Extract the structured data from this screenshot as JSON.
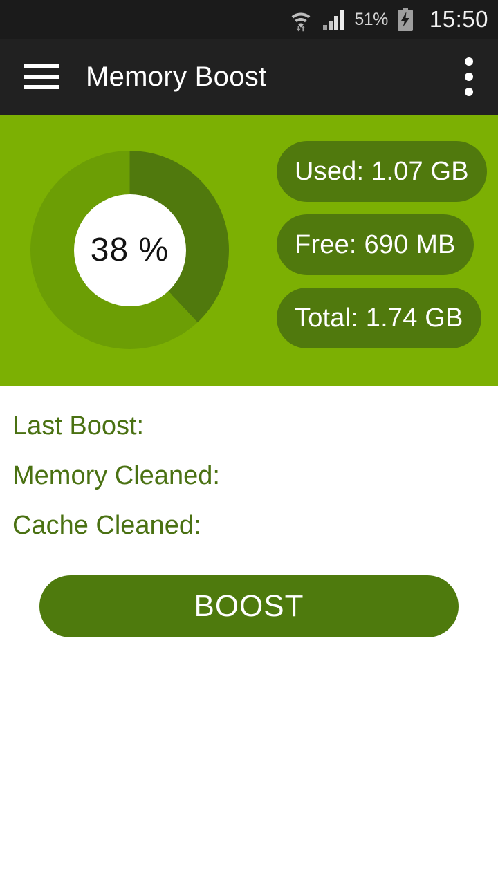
{
  "status_bar": {
    "wifi_icon": "wifi-icon",
    "signal_icon": "cellular-signal-icon",
    "battery_percent": "51%",
    "battery_icon": "battery-charging-icon",
    "time": "15:50"
  },
  "app_bar": {
    "menu_icon": "hamburger-menu-icon",
    "title": "Memory Boost",
    "overflow_icon": "overflow-menu-icon"
  },
  "memory": {
    "percent_label": "38 %",
    "percent_value": 38,
    "used": "Used: 1.07 GB",
    "free": "Free: 690 MB",
    "total": "Total: 1.74 GB"
  },
  "stats": [
    {
      "label": "Last Boost:",
      "value": ""
    },
    {
      "label": "Memory Cleaned:",
      "value": ""
    },
    {
      "label": "Cache Cleaned:",
      "value": ""
    }
  ],
  "actions": {
    "boost_label": "BOOST"
  },
  "colors": {
    "status_bar_bg": "#1b1b1b",
    "app_bar_bg": "#212121",
    "hero_bg": "#7CB003",
    "donut_track": "#6C9E05",
    "donut_arc": "#50790D",
    "pill_bg": "#50790D",
    "stat_text": "#4A7112",
    "boost_bg": "#4E7A0D"
  }
}
